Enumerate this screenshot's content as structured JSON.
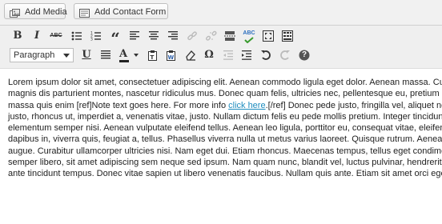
{
  "media_buttons": {
    "add_media": "Add Media",
    "add_contact_form": "Add Contact Form"
  },
  "toolbar": {
    "row1": [
      {
        "name": "bold-button",
        "glyph": "B"
      },
      {
        "name": "italic-button",
        "glyph": "I"
      },
      {
        "name": "strikethrough-button",
        "glyph": "ABC"
      },
      {
        "name": "bullet-list-button",
        "glyph": ""
      },
      {
        "name": "numbered-list-button",
        "glyph": ""
      },
      {
        "name": "blockquote-button",
        "glyph": "“"
      },
      {
        "name": "align-left-button",
        "glyph": ""
      },
      {
        "name": "align-center-button",
        "glyph": ""
      },
      {
        "name": "align-right-button",
        "glyph": ""
      },
      {
        "name": "insert-link-button",
        "glyph": ""
      },
      {
        "name": "remove-link-button",
        "glyph": ""
      },
      {
        "name": "read-more-button",
        "glyph": ""
      },
      {
        "name": "spellcheck-button",
        "glyph": "ABC"
      },
      {
        "name": "fullscreen-button",
        "glyph": ""
      },
      {
        "name": "kitchen-sink-button",
        "glyph": ""
      }
    ],
    "format_select": "Paragraph",
    "row2": [
      {
        "name": "underline-button",
        "glyph": "U"
      },
      {
        "name": "justify-button",
        "glyph": ""
      },
      {
        "name": "text-color-button",
        "glyph": "A"
      },
      {
        "name": "paste-text-button",
        "glyph": ""
      },
      {
        "name": "paste-word-button",
        "glyph": ""
      },
      {
        "name": "clear-formatting-button",
        "glyph": ""
      },
      {
        "name": "special-character-button",
        "glyph": "Ω"
      },
      {
        "name": "outdent-button",
        "glyph": ""
      },
      {
        "name": "indent-button",
        "glyph": ""
      },
      {
        "name": "undo-button",
        "glyph": ""
      },
      {
        "name": "redo-button",
        "glyph": ""
      },
      {
        "name": "help-button",
        "glyph": "?"
      }
    ]
  },
  "content": {
    "lines": [
      "Lorem ipsum dolor sit amet, consectetuer adipiscing elit. Aenean commodo ligula eget dolor. Aenean massa. Cum sociis",
      "magnis dis parturient montes, nascetur ridiculus mus. Donec quam felis, ultricies nec, pellentesque eu, pretium",
      "massa quis enim [ref]Note text goes here. For more info ",
      "justo, rhoncus ut, imperdiet a, venenatis vitae, justo. Nullam dictum felis eu pede mollis pretium. Integer tincidunt",
      "elementum semper nisi. Aenean vulputate eleifend tellus. Aenean leo ligula, porttitor eu, consequat vitae, eleifend",
      "dapibus in, viverra quis, feugiat a, tellus. Phasellus viverra nulla ut metus varius laoreet. Quisque rutrum. Aenean",
      "augue. Curabitur ullamcorper ultricies nisi. Nam eget dui. Etiam rhoncus. Maecenas tempus, tellus eget condimentum",
      "semper libero, sit amet adipiscing sem neque sed ipsum. Nam quam nunc, blandit vel, luctus pulvinar, hendrerit id",
      "ante tincidunt tempus. Donec vitae sapien ut libero venenatis faucibus. Nullam quis ante. Etiam sit amet orci eget"
    ],
    "link_text": "click here",
    "line3_after_link": ".[/ref] Donec pede justo, fringilla vel, aliquet nec, vulputate"
  },
  "colors": {
    "link": "#1e8cbe",
    "spellcheck_underline": "#e26b6b",
    "toolbar_bg": "#efefef"
  }
}
